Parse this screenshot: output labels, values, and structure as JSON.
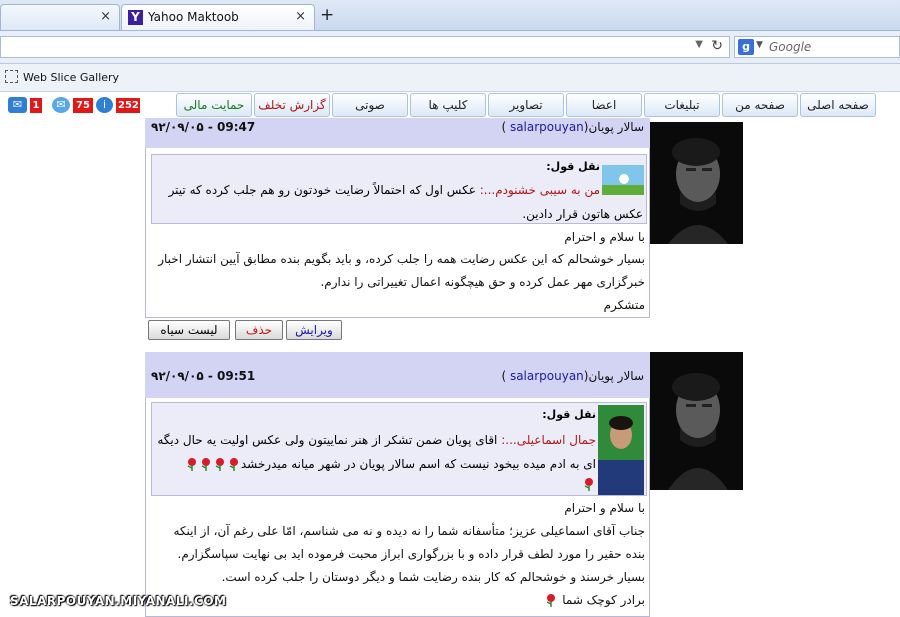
{
  "browser": {
    "tabs": [
      {
        "title": "",
        "close": "×"
      },
      {
        "title": "Yahoo Maktoob",
        "close": "×",
        "favicon": "Y"
      }
    ],
    "new_tab": "+",
    "search_placeholder": "Google",
    "search_engine_letter": "g",
    "favorites_bar": {
      "item": "Web Slice Gallery"
    }
  },
  "menu": {
    "items": [
      {
        "label": "صفحه اصلی"
      },
      {
        "label": "صفحه من"
      },
      {
        "label": "تبلیغات"
      },
      {
        "label": "اعضا"
      },
      {
        "label": "تصاویر"
      },
      {
        "label": "کلیپ ها"
      },
      {
        "label": "صوتی"
      },
      {
        "label": "گزارش تخلف",
        "color": "#b01818"
      },
      {
        "label": "حمایت مالی",
        "color": "#1a7a1a"
      }
    ],
    "badges": {
      "comments": "252",
      "chat": "75",
      "messages": "1"
    }
  },
  "posts": [
    {
      "author_name": "سالار پویان",
      "author_user": "salarpouyan",
      "date": "۹۲/۰۹/۰۵ - 09:47",
      "quote_label": "نقل قول:",
      "quote_author": "من به سیبی خشنودم...:",
      "quote_lines": [
        "عکس اول که احتمالاً رضایت خودتون رو هم جلب کرده که تیتر",
        "عکس هاتون قرار دادین."
      ],
      "body_lines": [
        "با سلام و احترام",
        "بسیار خوشحالم که این عکس رضایت همه را جلب کرده، و باید بگویم بنده مطابق آیین انتشار اخبار",
        "خبرگزاری مهر عمل کرده و حق هیچگونه اعمال تغییراتی را ندارم.",
        "متشکرم"
      ],
      "actions": {
        "edit": "ویرایش",
        "delete": "حذف",
        "blacklist": "لیست سیاه"
      }
    },
    {
      "author_name": "سالار پویان",
      "author_user": "salarpouyan",
      "date": "۹۲/۰۹/۰۵ - 09:51",
      "quote_label": "نقل قول:",
      "quote_author": "جمال اسماعیلی...:",
      "quote_lines": [
        "اقای پویان ضمن تشکر از هنر نماییتون ولی عکس اولیت یه حال دیگه",
        "ای به ادم میده بیخود نیست که اسم سالار پویان در شهر میانه میدرخشد"
      ],
      "body_lines": [
        "با سلام و احترام",
        "جناب آقای اسماعیلی عزیز؛ متأسفانه شما را نه دیده و نه می شناسم، امّا علی رغم آن، از اینکه",
        "بنده حقیر را مورد لطف قرار داده و با بزرگواری ابراز محبت فرموده اید بی نهایت سپاسگزارم.",
        "بسیار خرسند و خوشحالم که کار بنده رضایت شما و دیگر دوستان را جلب کرده است.",
        "برادر کوچک شما"
      ]
    }
  ],
  "watermark": "SALARPOUYAN.MIYANALI.COM",
  "colors": {
    "post_header": "#d3d3f4",
    "quote_bg": "#ececf8",
    "quote_name": "#b01818",
    "username": "#1a1aa8"
  }
}
